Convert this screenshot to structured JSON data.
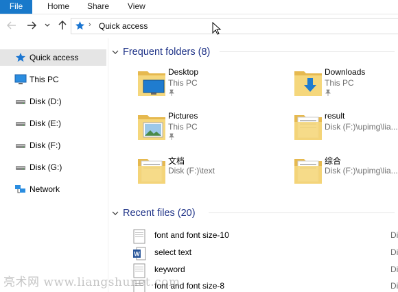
{
  "ribbon": {
    "tabs": [
      {
        "label": "File"
      },
      {
        "label": "Home"
      },
      {
        "label": "Share"
      },
      {
        "label": "View"
      }
    ]
  },
  "address": {
    "text": "Quick access"
  },
  "sidebar": {
    "items": [
      {
        "label": "Quick access",
        "icon": "star-icon"
      },
      {
        "label": "This PC",
        "icon": "monitor-icon"
      },
      {
        "label": "Disk (D:)",
        "icon": "drive-icon"
      },
      {
        "label": "Disk (E:)",
        "icon": "drive-icon"
      },
      {
        "label": "Disk (F:)",
        "icon": "drive-icon"
      },
      {
        "label": "Disk (G:)",
        "icon": "drive-icon"
      },
      {
        "label": "Network",
        "icon": "network-icon"
      }
    ]
  },
  "frequent": {
    "title": "Frequent folders (8)",
    "folders": [
      {
        "name": "Desktop",
        "sub": "This PC",
        "pinned": true
      },
      {
        "name": "Downloads",
        "sub": "This PC",
        "pinned": true
      },
      {
        "name": "Pictures",
        "sub": "This PC",
        "pinned": true
      },
      {
        "name": "result",
        "sub": "Disk (F:)\\upimg\\lia...",
        "pinned": false
      },
      {
        "name": "文档",
        "sub": "Disk (F:)\\text",
        "pinned": false
      },
      {
        "name": "综合",
        "sub": "Disk (F:)\\upimg\\lia...",
        "pinned": false
      }
    ]
  },
  "recent": {
    "title": "Recent files (20)",
    "files": [
      {
        "name": "font and font size-10",
        "tail": "Di"
      },
      {
        "name": "select text",
        "tail": "Di"
      },
      {
        "name": "keyword",
        "tail": "Di"
      },
      {
        "name": "font and font size-8",
        "tail": "Di"
      }
    ]
  },
  "watermark": "亮术网 www.liangshunet.com",
  "colors": {
    "file_tab": "#1979ca",
    "section_title": "#1e3287",
    "selection": "#e5e5e5"
  }
}
